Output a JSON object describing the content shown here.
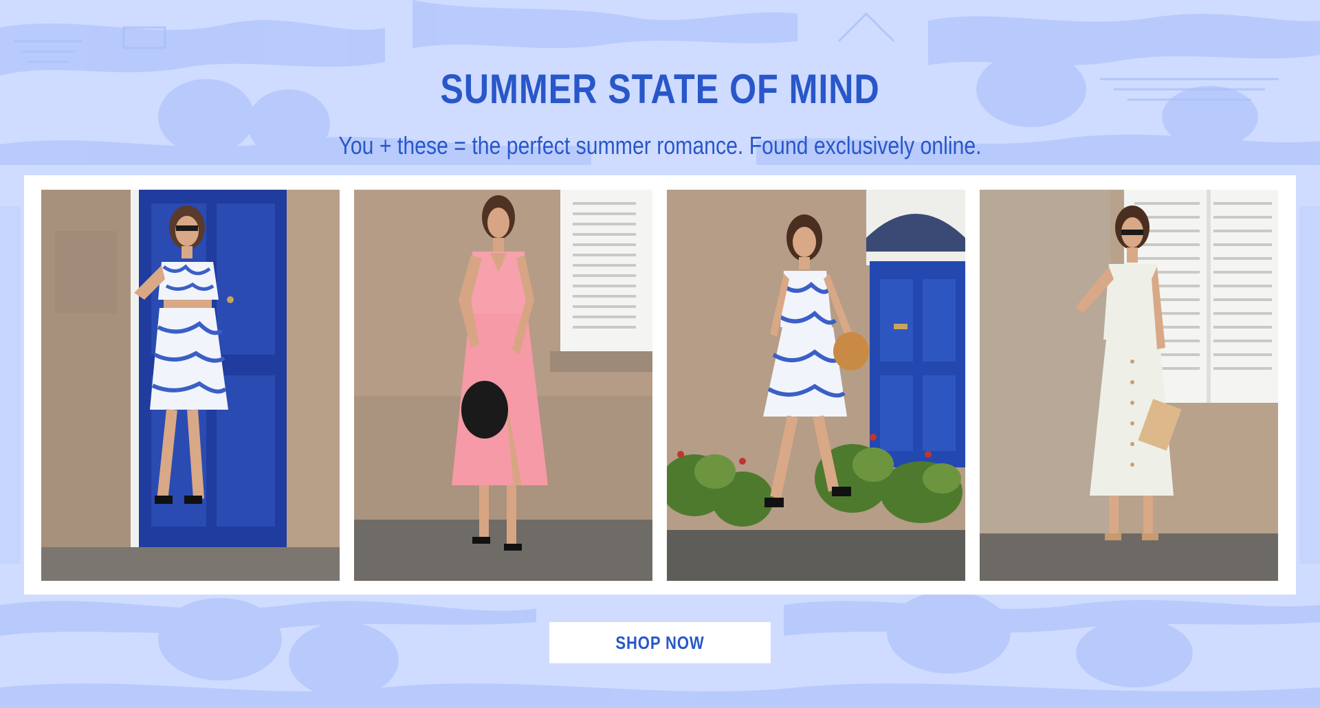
{
  "hero": {
    "title": "SUMMER STATE OF MIND",
    "subtitle": "You + these = the perfect summer romance. Found exclusively online."
  },
  "gallery": {
    "items": [
      {
        "outfit": "blue toile crop top and ruffle mini skirt",
        "backdrop": "blue door"
      },
      {
        "outfit": "pink satin midi dress",
        "backdrop": "white shutters"
      },
      {
        "outfit": "blue toile mini dress",
        "backdrop": "blue door with garden"
      },
      {
        "outfit": "white strapless button midi dress",
        "backdrop": "white shutters"
      }
    ]
  },
  "cta": {
    "label": "SHOP NOW"
  },
  "colors": {
    "brand_blue": "#2957c9",
    "background": "#cfdcff",
    "pattern": "#b0c6fb",
    "frame": "#ffffff"
  }
}
